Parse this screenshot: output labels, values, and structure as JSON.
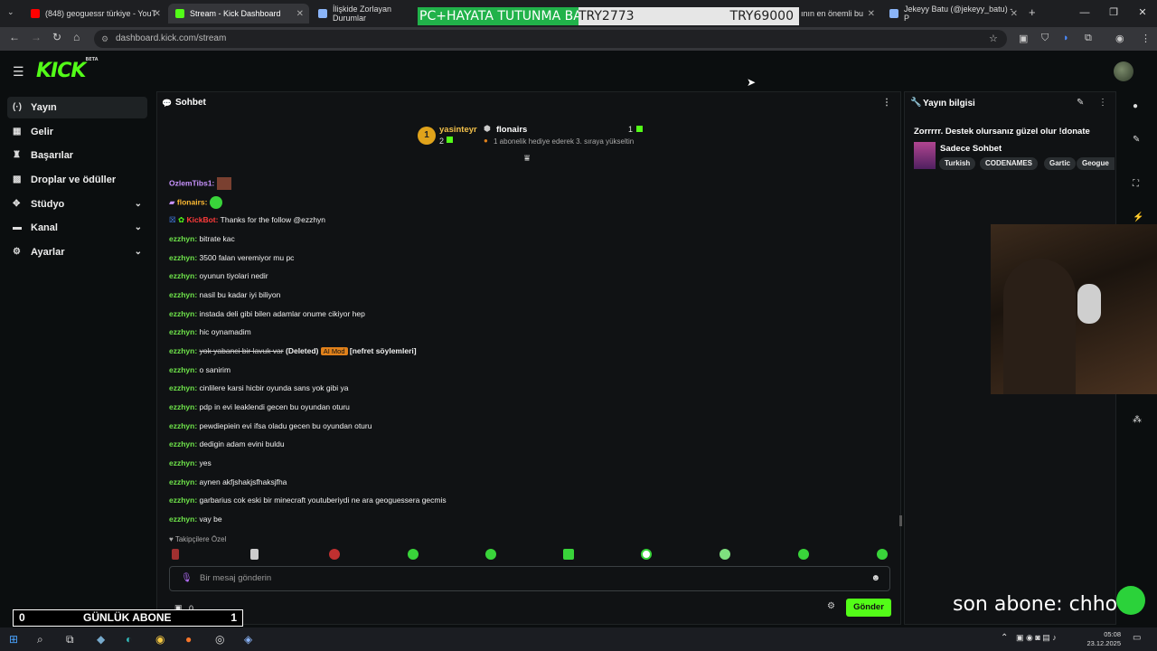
{
  "browser": {
    "tabs": [
      {
        "title": "(848) geoguessr türkiye - YouT",
        "color": "#ff0000"
      },
      {
        "title": "Stream - Kick Dashboard",
        "color": "#53fc18"
      },
      {
        "title": "İlişkide Zorlayan Durumlar",
        "color": "#8ab4f8"
      },
      {
        "title": "ının en önemli bu",
        "color": "#8ab4f8"
      },
      {
        "title": "Jekeyy Batu (@jekeyy_batu) - P",
        "color": "#8ab4f8"
      }
    ],
    "url": "dashboard.kick.com/stream"
  },
  "banner": {
    "left": "PC+HAYATA TUTUNMA BARI",
    "middle": "TRY2773",
    "right": "TRY69000"
  },
  "app": {
    "logo": "KICK",
    "logo_badge": "BETA"
  },
  "sidebar": {
    "items": [
      {
        "label": "Yayın",
        "icon": "broadcast-icon",
        "expandable": false
      },
      {
        "label": "Gelir",
        "icon": "money-icon",
        "expandable": false
      },
      {
        "label": "Başarılar",
        "icon": "trophy-icon",
        "expandable": false
      },
      {
        "label": "Droplar ve ödüller",
        "icon": "gift-icon",
        "expandable": false
      },
      {
        "label": "Stüdyo",
        "icon": "studio-icon",
        "expandable": true
      },
      {
        "label": "Kanal",
        "icon": "channel-icon",
        "expandable": true
      },
      {
        "label": "Ayarlar",
        "icon": "gear-icon",
        "expandable": true
      }
    ]
  },
  "chat": {
    "title": "Sohbet",
    "pinned": {
      "rank": "1",
      "user1": "yasinteyr",
      "user1_count": "2",
      "user2": "flonairs",
      "user2_count": "1",
      "text": "1 abonelik hediye ederek 3. sıraya yükseltin"
    },
    "messages": [
      {
        "user": "OzlemTibs1:",
        "text": "",
        "style": "u2"
      },
      {
        "user": "flonairs:",
        "text": "",
        "style": "u3"
      },
      {
        "user": "KickBot:",
        "text": "Thanks for the follow @ezzhyn",
        "style": "u4"
      },
      {
        "user": "ezzhyn:",
        "text": "bitrate kac",
        "style": "u"
      },
      {
        "user": "ezzhyn:",
        "text": "3500 falan veremiyor mu pc",
        "style": "u"
      },
      {
        "user": "ezzhyn:",
        "text": "oyunun tiyolari nedir",
        "style": "u"
      },
      {
        "user": "ezzhyn:",
        "text": "nasil bu kadar iyi biliyon",
        "style": "u"
      },
      {
        "user": "ezzhyn:",
        "text": "instada deli gibi bilen adamlar onume cikiyor hep",
        "style": "u"
      },
      {
        "user": "ezzhyn:",
        "text": "hic oynamadim",
        "style": "u"
      },
      {
        "user": "ezzhyn:",
        "text": "",
        "style": "u"
      },
      {
        "user": "ezzhyn:",
        "text": "o sanirim",
        "style": "u"
      },
      {
        "user": "ezzhyn:",
        "text": "cinlilere karsi hicbir oyunda sans yok gibi ya",
        "style": "u"
      },
      {
        "user": "ezzhyn:",
        "text": "pdp in evi leaklendi gecen bu oyundan oturu",
        "style": "u"
      },
      {
        "user": "ezzhyn:",
        "text": "pewdiepiein evi ifsa oladu gecen bu oyundan oturu",
        "style": "u"
      },
      {
        "user": "ezzhyn:",
        "text": "dedigin adam evini buldu",
        "style": "u"
      },
      {
        "user": "ezzhyn:",
        "text": "yes",
        "style": "u"
      },
      {
        "user": "ezzhyn:",
        "text": "aynen akfjshakjsfhaksjfha",
        "style": "u"
      },
      {
        "user": "ezzhyn:",
        "text": "garbarius cok eski bir minecraft youtuberiydi ne ara geoguessera gecmis",
        "style": "u"
      },
      {
        "user": "ezzhyn:",
        "text": "vay be",
        "style": "u"
      }
    ],
    "deleted": {
      "text": "yok yabanci bir lavuk var",
      "tag": "(Deleted)",
      "mod": "AI Mod",
      "reason": "[nefret söylemleri]"
    },
    "followers_only": "Takipçilere Özel",
    "input_placeholder": "Bir mesaj gönderin",
    "count": "0",
    "send": "Gönder"
  },
  "info": {
    "title": "Yayın bilgisi",
    "stream_title": "Zorrrrr. Destek olursanız güzel olur !donate",
    "category": "Sadece Sohbet",
    "tags": [
      "Turkish",
      "CODENAMES",
      "Gartic",
      "Geogue"
    ]
  },
  "overlay": {
    "daily_left": "0",
    "daily_label": "GÜNLÜK ABONE",
    "daily_right": "1",
    "last_sub": "son abone: chhote"
  },
  "taskbar": {
    "time": "05:08",
    "date": "23.12.2025"
  }
}
